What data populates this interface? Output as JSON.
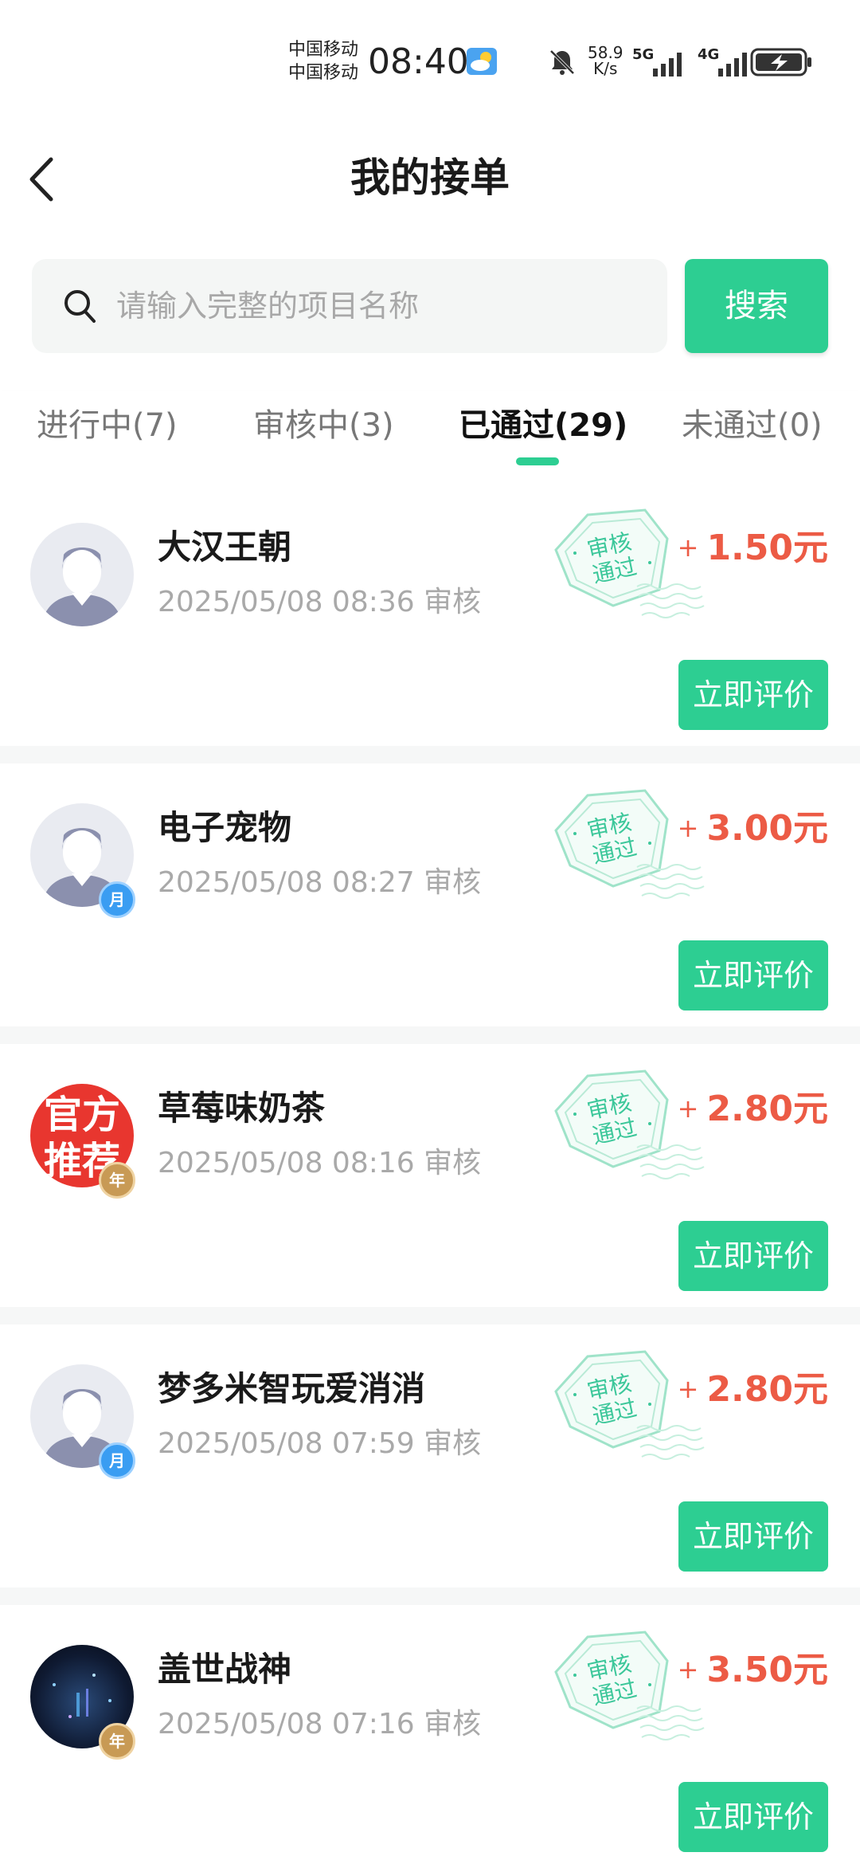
{
  "status_bar": {
    "carrier_1": "中国移动",
    "carrier_2": "中国移动",
    "time": "08:40",
    "net_speed_value": "58.9",
    "net_speed_unit": "K/s",
    "network_1": "5G",
    "network_2": "4G",
    "icons": [
      "weather-cloud-sun-icon",
      "bell-off-icon",
      "signal-icon",
      "battery-charging-icon"
    ]
  },
  "header": {
    "title": "我的接单",
    "back_icon": "chevron-left-icon"
  },
  "search": {
    "placeholder": "请输入完整的项目名称",
    "button_label": "搜索"
  },
  "tabs": [
    {
      "label": "进行中(7)",
      "active": false
    },
    {
      "label": "审核中(3)",
      "active": false
    },
    {
      "label": "已通过(29)",
      "active": true
    },
    {
      "label": "未通过(0)",
      "active": false
    }
  ],
  "orders": [
    {
      "name": "大汉王朝",
      "time": "2025/05/08 08:36 审核",
      "stamp": "审核通过",
      "stamp_line1": "审核",
      "stamp_line2": "通过",
      "plus": "+",
      "amount": "1.50元",
      "button": "立即评价",
      "avatar": "default-avatar",
      "badge": ""
    },
    {
      "name": "电子宠物",
      "time": "2025/05/08 08:27 审核",
      "stamp": "审核通过",
      "stamp_line1": "审核",
      "stamp_line2": "通过",
      "plus": "+",
      "amount": "3.00元",
      "button": "立即评价",
      "avatar": "default-avatar",
      "badge": "月"
    },
    {
      "name": "草莓味奶茶",
      "time": "2025/05/08 08:16 审核",
      "stamp": "审核通过",
      "stamp_line1": "审核",
      "stamp_line2": "通过",
      "plus": "+",
      "amount": "2.80元",
      "button": "立即评价",
      "avatar": "official",
      "avatar_text_1": "官方",
      "avatar_text_2": "推荐",
      "badge": "年"
    },
    {
      "name": "梦多米智玩爱消消",
      "time": "2025/05/08 07:59 审核",
      "stamp": "审核通过",
      "stamp_line1": "审核",
      "stamp_line2": "通过",
      "plus": "+",
      "amount": "2.80元",
      "button": "立即评价",
      "avatar": "default-avatar",
      "badge": "月"
    },
    {
      "name": "盖世战神",
      "time": "2025/05/08 07:16 审核",
      "stamp": "审核通过",
      "stamp_line1": "审核",
      "stamp_line2": "通过",
      "plus": "+",
      "amount": "3.50元",
      "button": "立即评价",
      "avatar": "dark-photo",
      "badge": "年"
    }
  ],
  "colors": {
    "accent": "#2dce92",
    "amount": "#ec5b45",
    "muted": "#a9a9a9",
    "stamp": "#3cc79a"
  }
}
